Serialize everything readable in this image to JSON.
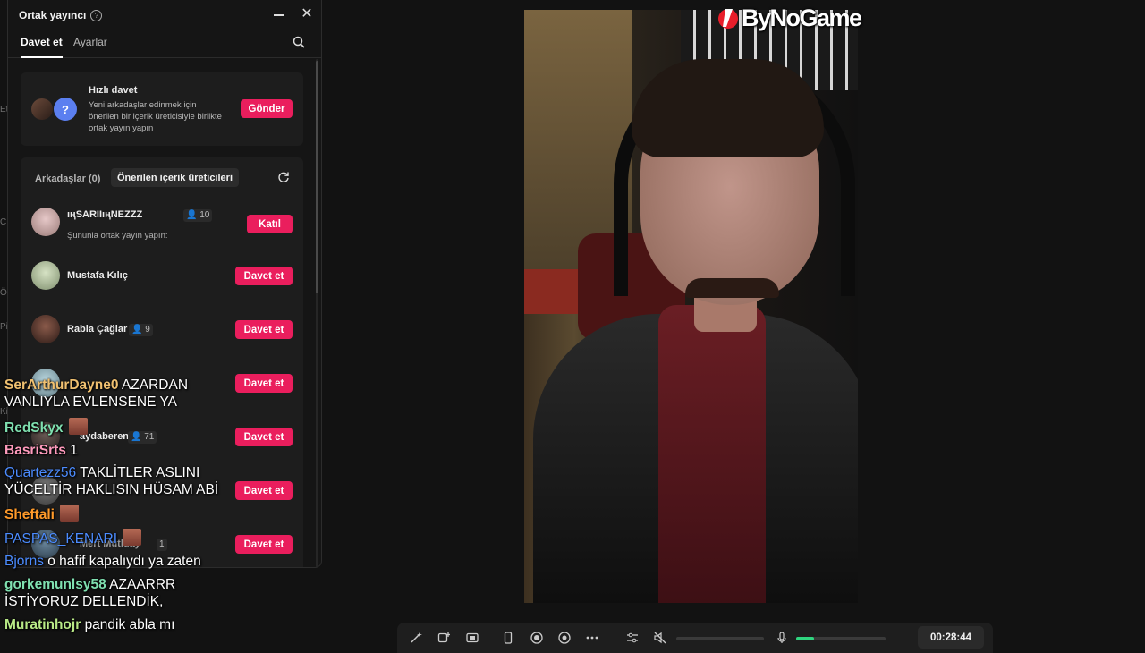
{
  "left_edge_letters": [
    "Et",
    "C",
    "Ö",
    "Pi",
    "Ki"
  ],
  "panel": {
    "title": "Ortak yayıncı",
    "tabs": {
      "invite": "Davet et",
      "settings": "Ayarlar"
    },
    "quick_invite": {
      "title": "Hızlı davet",
      "description": "Yeni arkadaşlar edinmek için önerilen bir içerik üreticisiyle birlikte ortak yayın yapın",
      "avatar_glyph": "?",
      "button": "Gönder"
    },
    "subtabs": {
      "friends": "Arkadaşlar (0)",
      "suggested": "Önerilen içerik üreticileri"
    },
    "creators": [
      {
        "name": "ıңSARIIıңNEZZZ",
        "viewers": "10",
        "collab_text": "Şununla ortak yayın yapın:",
        "button": "Katıl"
      },
      {
        "name": "Mustafa Kılıç",
        "viewers": "",
        "button": "Davet et"
      },
      {
        "name": "Rabia Çağlar",
        "viewers": "9",
        "button": "Davet et"
      },
      {
        "name": "",
        "viewers": "",
        "button": "Davet et"
      },
      {
        "name": "aydaberenn",
        "viewers": "71",
        "button": "Davet et"
      },
      {
        "name": "",
        "viewers": "",
        "button": "Davet et"
      },
      {
        "name": "Mert Mutluay",
        "viewers": "1",
        "button": "Davet et"
      }
    ]
  },
  "chat": [
    {
      "user": "SerArthurDayne0",
      "color": "#f0c070",
      "text": "AZARDAN",
      "text2": "VANLIYLA EVLENSENE YA"
    },
    {
      "user": "RedSkyx",
      "color": "#7fe0b0",
      "text": "",
      "emote": true
    },
    {
      "user": "BasriSrts",
      "color": "#ff9bbd",
      "text": "1"
    },
    {
      "user": "Quartezz56",
      "color": "#4c8cff",
      "text": "TAKLİTLER ASLINI",
      "text2": "YÜCELTİR HAKLISIN HÜSAM ABİ"
    },
    {
      "user": "Sheftali",
      "color": "#ff9a2a",
      "text": "",
      "emote": true
    },
    {
      "user": "PASPAS_KENARI",
      "color": "#4c8cff",
      "text": "",
      "emote": true
    },
    {
      "user": "Bjorns",
      "color": "#4c8cff",
      "text": "o hafif kapalıydı ya zaten"
    },
    {
      "user": "gorkemunlsy58",
      "color": "#7fe0b0",
      "text": "AZAARRR",
      "text2": "İSTİYORUZ DELLENDİK,"
    },
    {
      "user": "Muratinhojr",
      "color": "#b8e986",
      "text": "pandik abla mı"
    }
  ],
  "logo": {
    "text": "ByNoGame"
  },
  "toolbar": {
    "timer": "00:28:44",
    "volume_level": 0.0,
    "mic_level": 0.2
  },
  "colors": {
    "accent": "#ea1e5d",
    "meter": "#2fd57f"
  }
}
